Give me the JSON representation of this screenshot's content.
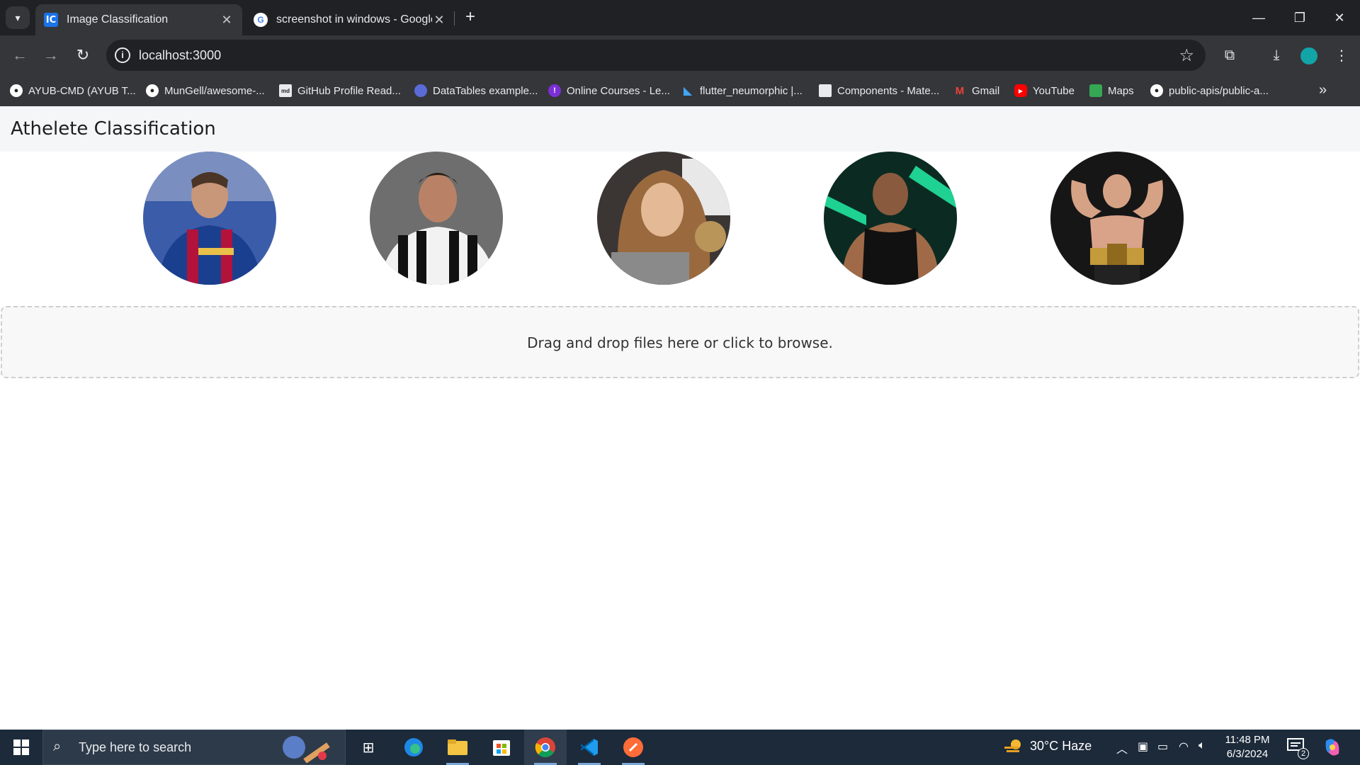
{
  "browser": {
    "tabs": [
      {
        "title": "Image Classification",
        "favicon": "IC",
        "active": true
      },
      {
        "title": "screenshot in windows - Google Search",
        "favicon": "G",
        "active": false
      }
    ],
    "url": "localhost:3000",
    "bookmarks": [
      {
        "label": "AYUB-CMD (AYUB T...",
        "icon": "github-icon",
        "color": "#ffffff"
      },
      {
        "label": "MunGell/awesome-...",
        "icon": "github-icon",
        "color": "#ffffff"
      },
      {
        "label": "GitHub Profile Read...",
        "icon": "readme-icon",
        "color": "#e8eaed"
      },
      {
        "label": "DataTables example...",
        "icon": "datatables-icon",
        "color": "#5b6bd6"
      },
      {
        "label": "Online Courses - Le...",
        "icon": "courses-icon",
        "color": "#7b2fd6"
      },
      {
        "label": "flutter_neumorphic |...",
        "icon": "flutter-icon",
        "color": "#42a5f5"
      },
      {
        "label": "Components - Mate...",
        "icon": "components-icon",
        "color": "#e8eaed"
      },
      {
        "label": "Gmail",
        "icon": "gmail-icon",
        "color": "#ea4335"
      },
      {
        "label": "YouTube",
        "icon": "youtube-icon",
        "color": "#ff0000"
      },
      {
        "label": "Maps",
        "icon": "maps-icon",
        "color": "#34a853"
      },
      {
        "label": "public-apis/public-a...",
        "icon": "github-icon",
        "color": "#ffffff"
      }
    ]
  },
  "page": {
    "title": "Athelete Classification",
    "athletes": [
      {
        "name": "athlete-1",
        "bg": "#1b3f8f",
        "accent": "#b3123b"
      },
      {
        "name": "athlete-2",
        "bg": "#5e5e5e",
        "accent": "#1a1a1a"
      },
      {
        "name": "athlete-3",
        "bg": "#6f5a45",
        "accent": "#d9b98a"
      },
      {
        "name": "athlete-4",
        "bg": "#0e3c2e",
        "accent": "#1a1a1a"
      },
      {
        "name": "athlete-5",
        "bg": "#141414",
        "accent": "#d9a38a"
      }
    ],
    "dropzone_text": "Drag and drop files here or click to browse."
  },
  "taskbar": {
    "search_placeholder": "Type here to search",
    "weather": "30°C  Haze",
    "time": "11:48 PM",
    "date": "6/3/2024",
    "notification_count": "2"
  }
}
